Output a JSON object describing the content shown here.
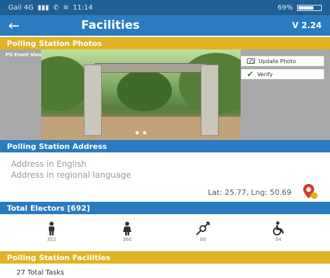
{
  "status_bar": {
    "network_left": "Gail 4G",
    "time": "11:14",
    "battery": "69%",
    "battery_level": 0.69
  },
  "app_bar": {
    "title": "Facilities",
    "version": "V 2.24"
  },
  "photos_section": {
    "title": "Polling Station Photos",
    "photo_label": "PS Front View",
    "update_photo_label": "Update Photo",
    "verify_label": "Verify",
    "slide_count": 2
  },
  "address_section": {
    "title": "Polling Station Address",
    "address_english_placeholder": "Address in English",
    "address_regional_placeholder": "Address in regional language",
    "latlng": "Lat: 25.77, Lng: 50.69"
  },
  "electors_section": {
    "title": "Total Electors [692]",
    "items": [
      {
        "icon": "male-icon",
        "count": "352"
      },
      {
        "icon": "female-icon",
        "count": "360"
      },
      {
        "icon": "third-gender-icon",
        "count": "00"
      },
      {
        "icon": "wheelchair-icon",
        "count": "04"
      }
    ]
  },
  "facilities_section": {
    "title": "Polling Station Facilities",
    "tasks_text": "27 Total Tasks"
  },
  "colors": {
    "primary": "#2a7bbf",
    "accent": "#e0b324",
    "status_bar": "#1f5f93"
  }
}
